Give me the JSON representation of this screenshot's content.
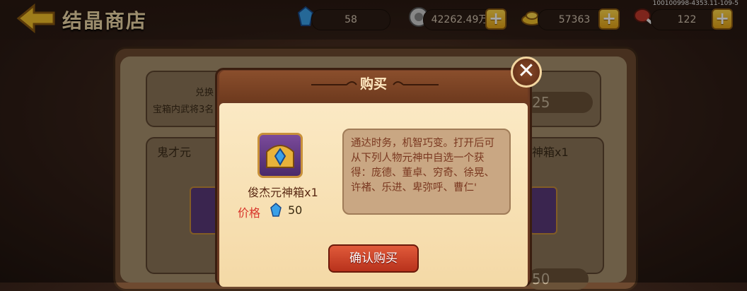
{
  "header": {
    "title": "结晶商店",
    "version": "100100998-4353.11-109-5"
  },
  "resources": [
    {
      "icon": "crystal-icon",
      "value": "58"
    },
    {
      "icon": "silver-coin-icon",
      "value": "42262.49万"
    },
    {
      "icon": "gold-ingot-icon",
      "value": "57363"
    },
    {
      "icon": "meat-icon",
      "value": "122"
    }
  ],
  "background": {
    "card1_line1": "兑换",
    "card1_line2": "宝箱内武将3名",
    "card1_price": "25",
    "card2_label_left": "鬼才元",
    "card2_label_right": "神箱x1",
    "card3_price": "50"
  },
  "modal": {
    "title": "购买",
    "item_name": "俊杰元神箱x1",
    "price_label": "价格",
    "price_value": "50",
    "description": "通达时务，机智巧变。打开后可从下列人物元神中自选一个获得：庞德、董卓、穷奇、徐晃、许褚、乐进、卑弥呼、曹仁'",
    "confirm_label": "确认购买",
    "close_label": "✕"
  },
  "colors": {
    "accent": "#c8392a",
    "gold": "#f3c12a",
    "panel": "#f4d9a6"
  }
}
